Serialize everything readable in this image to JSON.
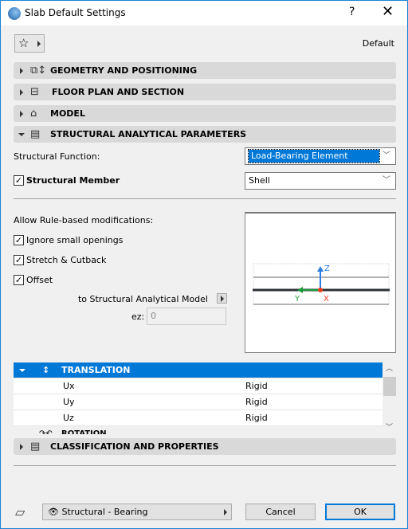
{
  "window": {
    "title": "Slab Default Settings",
    "help": "?",
    "close": "✕"
  },
  "favorites": {
    "label": "Default"
  },
  "sections": [
    {
      "label": "GEOMETRY AND POSITIONING",
      "icon": "geometry-icon",
      "expanded": false
    },
    {
      "label": "FLOOR PLAN AND SECTION",
      "icon": "floor-plan-icon",
      "expanded": false
    },
    {
      "label": "MODEL",
      "icon": "model-icon",
      "expanded": false
    },
    {
      "label": "STRUCTURAL ANALYTICAL PARAMETERS",
      "icon": "structural-icon",
      "expanded": true
    },
    {
      "label": "CLASSIFICATION AND PROPERTIES",
      "icon": "document-icon",
      "expanded": false
    }
  ],
  "structural": {
    "function_label": "Structural Function:",
    "function_value": "Load-Bearing Element",
    "member_label": "Structural Member",
    "member_checked": true,
    "member_value": "Shell",
    "rules_label": "Allow Rule-based modifications:",
    "options": [
      {
        "label": "Ignore small openings",
        "checked": true
      },
      {
        "label": "Stretch & Cutback",
        "checked": true
      },
      {
        "label": "Offset",
        "checked": true
      }
    ],
    "offset_target": "to Structural Analytical Model",
    "ez_label": "ez:",
    "ez_value": "0",
    "axes": {
      "z": "Z",
      "y": "Y",
      "x": "X"
    }
  },
  "table": {
    "translation": "TRANSLATION",
    "rows": [
      {
        "name": "Ux",
        "value": "Rigid"
      },
      {
        "name": "Uy",
        "value": "Rigid"
      },
      {
        "name": "Uz",
        "value": "Rigid"
      }
    ],
    "rotation": "ROTATION"
  },
  "footer": {
    "layer": "Structural - Bearing",
    "cancel": "Cancel",
    "ok": "OK"
  },
  "colors": {
    "accent": "#0078d7"
  }
}
